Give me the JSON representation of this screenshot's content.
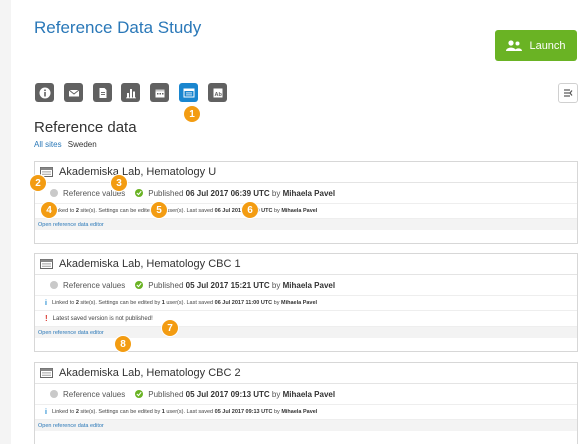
{
  "header": {
    "study_title": "Reference Data Study",
    "launch_label": "Launch",
    "accent_color": "#2a78b8",
    "launch_color": "#6ab324"
  },
  "toolbar": {
    "icons": [
      "info-icon",
      "mail-icon",
      "document-icon",
      "bar-chart-icon",
      "calendar-icon",
      "reference-data-icon",
      "text-block-icon"
    ],
    "active_icon": "reference-data-icon",
    "hide_icon": "hide-panel-icon"
  },
  "section": {
    "title": "Reference data",
    "filter_all": "All sites",
    "filter_country": "Sweden"
  },
  "badges": [
    "1",
    "2",
    "3",
    "4",
    "5",
    "6",
    "7",
    "8"
  ],
  "cards": [
    {
      "title": "Akademiska Lab, Hematology U",
      "status_label": "Reference values",
      "published_prefix": "Published",
      "published_date": "06 Jul 2017 06:39 UTC",
      "by": "by",
      "author": "Mihaela Pavel",
      "info_linked_prefix": "Linked to",
      "info_sites": "2",
      "info_sites_suffix": "site(s). Settings can be edited by",
      "info_users": "1",
      "info_users_suffix": "user(s). Last saved",
      "info_saved": "06 Jul 2017 06:39 UTC",
      "info_by": "by",
      "info_author": "Mihaela Pavel",
      "editor_link": "Open reference data editor"
    },
    {
      "title": "Akademiska Lab, Hematology CBC 1",
      "status_label": "Reference values",
      "published_prefix": "Published",
      "published_date": "05 Jul 2017 15:21 UTC",
      "by": "by",
      "author": "Mihaela Pavel",
      "info_linked_prefix": "Linked to",
      "info_sites": "2",
      "info_sites_suffix": "site(s). Settings can be edited by",
      "info_users": "1",
      "info_users_suffix": "user(s). Last saved",
      "info_saved": "06 Jul 2017 11:00 UTC",
      "info_by": "by",
      "info_author": "Mihaela Pavel",
      "warning": "Latest saved version is not published!",
      "editor_link": "Open reference data editor"
    },
    {
      "title": "Akademiska Lab, Hematology CBC 2",
      "status_label": "Reference values",
      "published_prefix": "Published",
      "published_date": "05 Jul 2017 09:13 UTC",
      "by": "by",
      "author": "Mihaela Pavel",
      "info_linked_prefix": "Linked to",
      "info_sites": "2",
      "info_sites_suffix": "site(s). Settings can be edited by",
      "info_users": "1",
      "info_users_suffix": "user(s). Last saved",
      "info_saved": "05 Jul 2017 09:13 UTC",
      "info_by": "by",
      "info_author": "Mihaela Pavel",
      "editor_link": "Open reference data editor"
    }
  ]
}
